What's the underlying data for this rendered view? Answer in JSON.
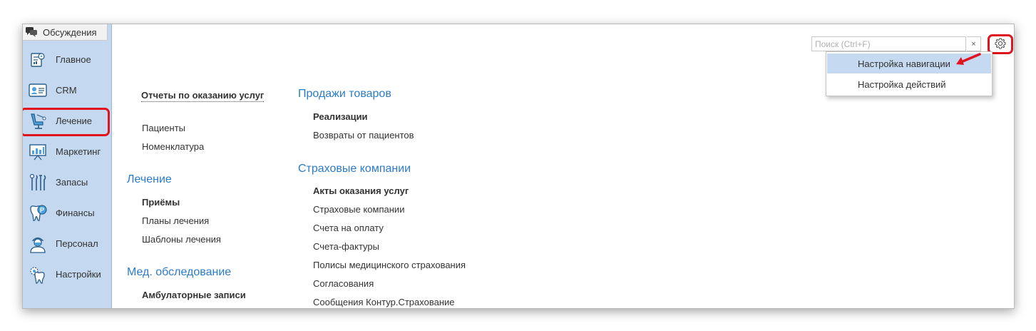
{
  "sidebar": {
    "discussions_label": "Обсуждения",
    "items": [
      {
        "label": "Главное",
        "icon": "home-chart-icon"
      },
      {
        "label": "CRM",
        "icon": "crm-card-icon"
      },
      {
        "label": "Лечение",
        "icon": "dental-chair-icon"
      },
      {
        "label": "Маркетинг",
        "icon": "presentation-board-icon"
      },
      {
        "label": "Запасы",
        "icon": "dental-tools-icon"
      },
      {
        "label": "Финансы",
        "icon": "tooth-coin-icon"
      },
      {
        "label": "Персонал",
        "icon": "doctor-icon"
      },
      {
        "label": "Настройки",
        "icon": "tooth-gear-icon"
      }
    ],
    "highlighted_item": "Лечение"
  },
  "search": {
    "placeholder": "Поиск (Ctrl+F)",
    "value": "",
    "clear_label": "×"
  },
  "settings_menu": {
    "items": [
      "Настройка навигации",
      "Настройка действий"
    ],
    "active_item": "Настройка навигации"
  },
  "columns": {
    "left": {
      "top_link": "Отчеты по оказанию услуг",
      "top_links": [
        "Пациенты",
        "Номенклатура"
      ],
      "groups": [
        {
          "title": "Лечение",
          "links": [
            {
              "label": "Приёмы",
              "bold": true
            },
            {
              "label": "Планы лечения",
              "bold": false
            },
            {
              "label": "Шаблоны лечения",
              "bold": false
            }
          ]
        },
        {
          "title": "Мед. обследование",
          "links": [
            {
              "label": "Амбулаторные записи",
              "bold": true
            }
          ]
        }
      ]
    },
    "right": {
      "groups": [
        {
          "title": "Продажи товаров",
          "links": [
            {
              "label": "Реализации",
              "bold": true
            },
            {
              "label": "Возвраты от пациентов",
              "bold": false
            }
          ]
        },
        {
          "title": "Страховые компании",
          "links": [
            {
              "label": "Акты оказания услуг",
              "bold": true
            },
            {
              "label": "Страховые компании",
              "bold": false
            },
            {
              "label": "Счета на оплату",
              "bold": false
            },
            {
              "label": "Счета-фактуры",
              "bold": false
            },
            {
              "label": "Полисы медицинского страхования",
              "bold": false
            },
            {
              "label": "Согласования",
              "bold": false
            },
            {
              "label": "Сообщения Контур.Страхование",
              "bold": false
            }
          ]
        }
      ]
    }
  },
  "colors": {
    "sidebar_bg": "#c4d8ef",
    "group_title": "#2c7cc5",
    "highlight_red": "#e0141e",
    "menu_active": "#c5d9f1"
  }
}
